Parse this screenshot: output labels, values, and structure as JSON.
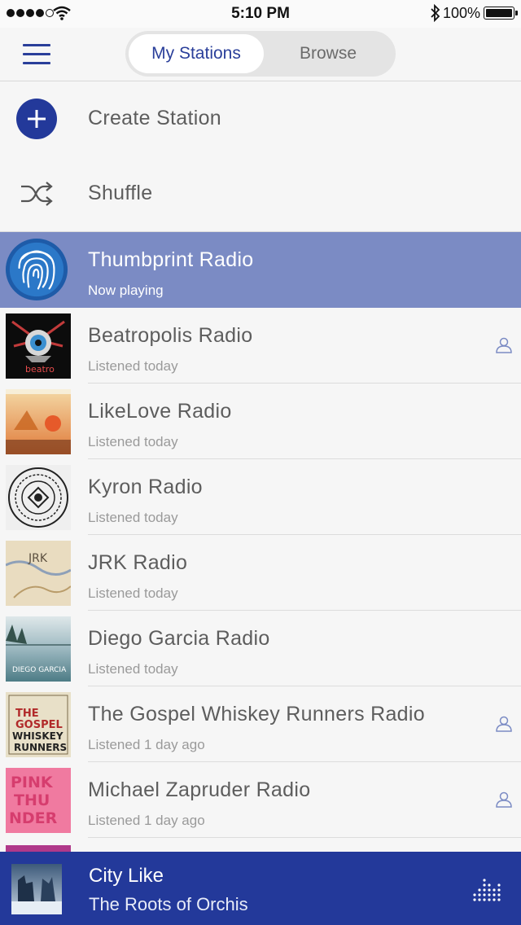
{
  "status_bar": {
    "time": "5:10 PM",
    "battery": "100%"
  },
  "header": {
    "tabs": [
      {
        "label": "My Stations",
        "active": true
      },
      {
        "label": "Browse",
        "active": false
      }
    ]
  },
  "actions": {
    "create": "Create Station",
    "shuffle": "Shuffle"
  },
  "stations": [
    {
      "name": "Thumbprint Radio",
      "status": "Now playing",
      "playing": true,
      "shared": false
    },
    {
      "name": "Beatropolis Radio",
      "status": "Listened today",
      "shared": true,
      "art_text": "beatro"
    },
    {
      "name": "LikeLove Radio",
      "status": "Listened today",
      "shared": false
    },
    {
      "name": "Kyron Radio",
      "status": "Listened today",
      "shared": false
    },
    {
      "name": "JRK Radio",
      "status": "Listened today",
      "shared": false,
      "art_text": "JRK"
    },
    {
      "name": "Diego Garcia Radio",
      "status": "Listened today",
      "shared": false,
      "art_text": "DIEGO GARCIA"
    },
    {
      "name": "The Gospel Whiskey Runners Radio",
      "status": "Listened 1 day ago",
      "shared": true,
      "art_text": [
        "THE",
        "GOSPEL",
        "WHISKEY",
        "RUNNERS"
      ]
    },
    {
      "name": "Michael Zapruder Radio",
      "status": "Listened 1 day ago",
      "shared": true,
      "art_text": [
        "PINK",
        "THU",
        "NDER"
      ]
    }
  ],
  "now_playing": {
    "track": "City Like",
    "artist": "The Roots of Orchis"
  },
  "colors": {
    "brand": "#23399a",
    "playing_row": "#7b8bc4"
  }
}
